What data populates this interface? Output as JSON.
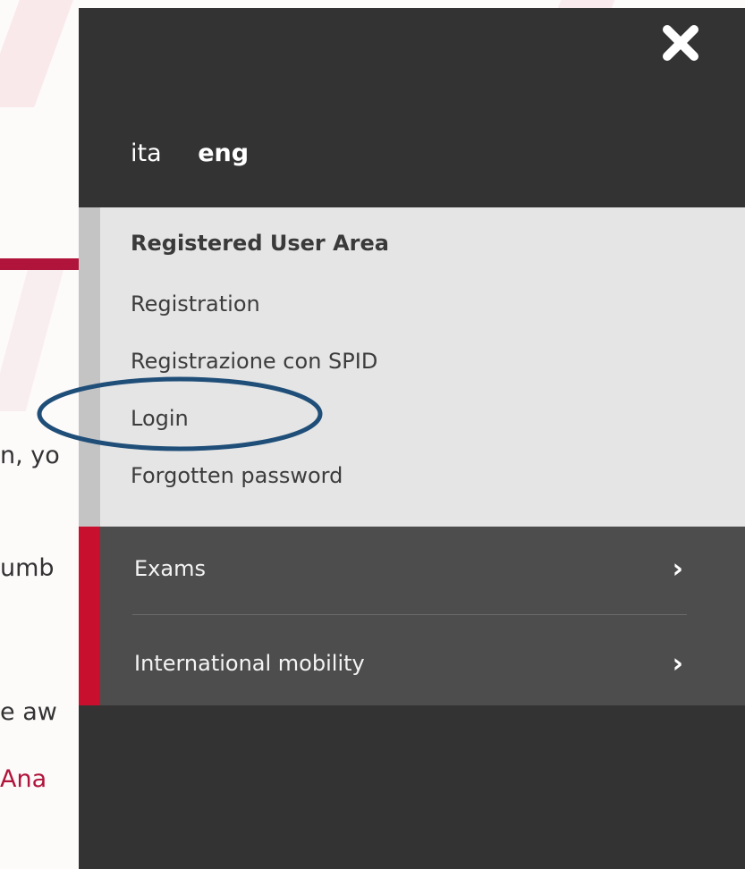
{
  "background_page": {
    "text_lines": [
      "n, yo",
      "umb",
      "e aw",
      "Ana"
    ]
  },
  "menu": {
    "close_icon": "close-icon",
    "languages": {
      "ita": "ita",
      "eng": "eng",
      "selected": "eng"
    },
    "user_area": {
      "title": "Registered User Area",
      "links": [
        "Registration",
        "Registrazione con SPID",
        "Login",
        "Forgotten password"
      ]
    },
    "nav": [
      {
        "label": "Exams",
        "icon": "chevron-right-icon"
      },
      {
        "label": "International mobility",
        "icon": "chevron-right-icon"
      }
    ]
  },
  "colors": {
    "panel": "#333333",
    "user_area": "#e5e5e5",
    "nav": "#4d4d4d",
    "accent": "#c8102e",
    "annotation": "#1f4e79"
  }
}
